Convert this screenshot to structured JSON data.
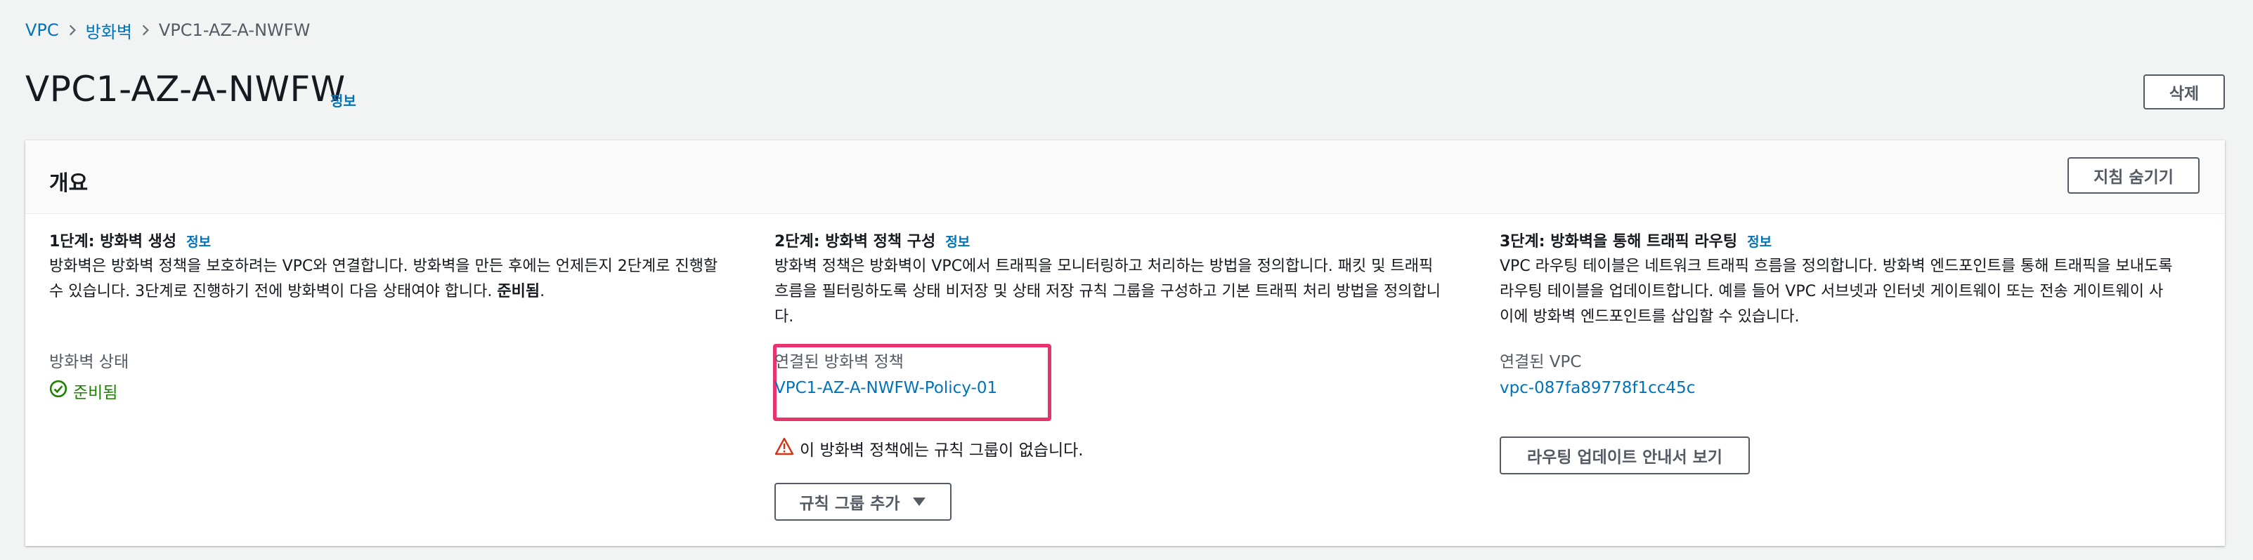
{
  "breadcrumb": {
    "items": [
      "VPC",
      "방화벽",
      "VPC1-AZ-A-NWFW"
    ]
  },
  "header": {
    "title": "VPC1-AZ-A-NWFW",
    "info": "정보",
    "delete_label": "삭제"
  },
  "overview": {
    "title": "개요",
    "hide_steps_label": "지침 숨기기",
    "step1": {
      "title": "1단계: 방화벽 생성",
      "info": "정보",
      "desc_line1": "방화벽은 방화벽 정책을 보호하려는 VPC와 연결합니다. 방화벽을 만든 후에는 언제든지 2단계로 진행할",
      "desc_line2": "수 있습니다. 3단계로 진행하기 전에 방화벽이 다음 상태여야 합니다. ",
      "desc_bold": "준비됨",
      "desc_end": ".",
      "kv_label": "방화벽 상태",
      "kv_value": "준비됨"
    },
    "step2": {
      "title": "2단계: 방화벽 정책 구성",
      "info": "정보",
      "desc_line1": "방화벽 정책은 방화벽이 VPC에서 트래픽을 모니터링하고 처리하는 방법을 정의합니다. 패킷 및 트래픽",
      "desc_line2": "흐름을 필터링하도록 상태 비저장 및 상태 저장 규칙 그룹을 구성하고 기본 트래픽 처리 방법을 정의합니",
      "desc_line3": "다.",
      "kv_label": "연결된 방화벽 정책",
      "kv_value": "VPC1-AZ-A-NWFW-Policy-01",
      "warning": "이 방화벽 정책에는 규칙 그룹이 없습니다.",
      "add_rule_group_label": "규칙 그룹 추가"
    },
    "step3": {
      "title": "3단계: 방화벽을 통해 트래픽 라우팅",
      "info": "정보",
      "desc_line1": "VPC 라우팅 테이블은 네트워크 트래픽 흐름을 정의합니다. 방화벽 엔드포인트를 통해 트래픽을 보내도록",
      "desc_line2": "라우팅 테이블을 업데이트합니다. 예를 들어 VPC 서브넷과 인터넷 게이트웨이 또는 전송 게이트웨이 사",
      "desc_line3": "이에 방화벽 엔드포인트를 삽입할 수 있습니다.",
      "kv_label": "연결된 VPC",
      "kv_value": "vpc-087fa89778f1cc45c",
      "routing_guide_label": "라우팅 업데이트 안내서 보기"
    }
  },
  "colors": {
    "link": "#0073bb",
    "success": "#1d8102",
    "warning": "#d13212",
    "highlight": "#e8336d"
  }
}
